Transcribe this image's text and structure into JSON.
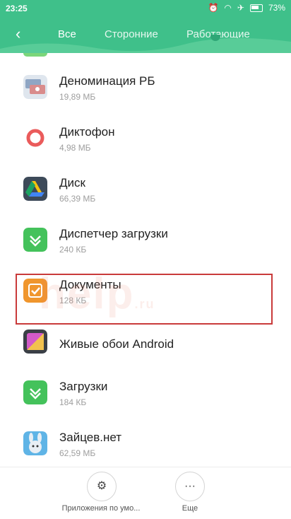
{
  "status": {
    "time": "23:25",
    "battery": "73%"
  },
  "tabs": [
    "Все",
    "Сторонние",
    "Работающие"
  ],
  "apps": [
    {
      "name": "Деноминация РБ",
      "size": "19,89 МБ",
      "icon": "banknotes-icon"
    },
    {
      "name": "Диктофон",
      "size": "4,98 МБ",
      "icon": "record-icon"
    },
    {
      "name": "Диск",
      "size": "66,39 МБ",
      "icon": "drive-icon"
    },
    {
      "name": "Диспетчер загрузки",
      "size": "240 КБ",
      "icon": "download-manager-icon"
    },
    {
      "name": "Документы",
      "size": "128 КБ",
      "icon": "documents-icon"
    },
    {
      "name": "Живые обои Android",
      "size": "",
      "icon": "live-wallpaper-icon"
    },
    {
      "name": "Загрузки",
      "size": "184 КБ",
      "icon": "downloads-icon"
    },
    {
      "name": "Зайцев.нет",
      "size": "62,59 МБ",
      "icon": "zaycev-icon"
    }
  ],
  "watermark": "help",
  "watermark_suffix": ".ru",
  "bottom": {
    "default_apps_label": "Приложения по умо...",
    "more_label": "Еще"
  },
  "colors": {
    "accent": "#3fc08a",
    "highlight": "#c93a3a"
  }
}
